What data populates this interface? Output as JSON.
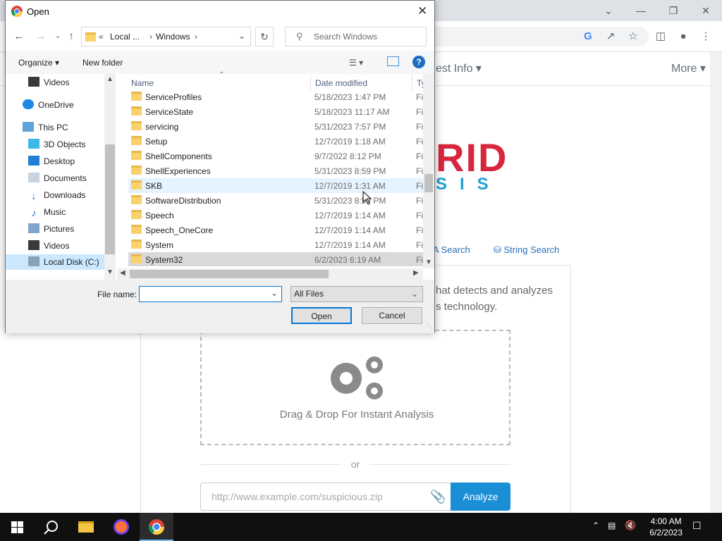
{
  "browser": {
    "nav_links": {
      "latest_info": "est Info ▾",
      "more": "More ▾"
    },
    "logo": {
      "text": "RID",
      "sub": "SIS"
    },
    "search_tabs": {
      "yara": "A Search",
      "string": "String Search"
    },
    "description": {
      "line1": "hat detects and analyzes",
      "line2": "s technology."
    },
    "dropzone_label": "Drag & Drop For Instant Analysis",
    "or_label": "or",
    "url_placeholder": "http://www.example.com/suspicious.zip",
    "analyze_label": "Analyze"
  },
  "dialog": {
    "title": "Open",
    "breadcrumb": {
      "chevrons": "«",
      "part1": "Local ...",
      "part2": "Windows"
    },
    "search_placeholder": "Search Windows",
    "organize_label": "Organize ▾",
    "new_folder_label": "New folder",
    "nav_items": [
      {
        "label": "Videos",
        "icon": "video-icon"
      },
      {
        "label": "OneDrive",
        "icon": "cloud-icon"
      },
      {
        "label": "This PC",
        "icon": "pc-icon"
      },
      {
        "label": "3D Objects",
        "icon": "cube-icon"
      },
      {
        "label": "Desktop",
        "icon": "desktop-icon"
      },
      {
        "label": "Documents",
        "icon": "document-icon"
      },
      {
        "label": "Downloads",
        "icon": "download-icon"
      },
      {
        "label": "Music",
        "icon": "music-icon"
      },
      {
        "label": "Pictures",
        "icon": "picture-icon"
      },
      {
        "label": "Videos",
        "icon": "video-icon"
      },
      {
        "label": "Local Disk (C:)",
        "icon": "drive-icon"
      }
    ],
    "columns": {
      "name": "Name",
      "date": "Date modified",
      "type": "Ty"
    },
    "files": [
      {
        "name": "ServiceProfiles",
        "date": "5/18/2023 1:47 PM",
        "type": "Fi"
      },
      {
        "name": "ServiceState",
        "date": "5/18/2023 11:17 AM",
        "type": "Fi"
      },
      {
        "name": "servicing",
        "date": "5/31/2023 7:57 PM",
        "type": "Fi"
      },
      {
        "name": "Setup",
        "date": "12/7/2019 1:18 AM",
        "type": "Fi"
      },
      {
        "name": "ShellComponents",
        "date": "9/7/2022 8:12 PM",
        "type": "Fi"
      },
      {
        "name": "ShellExperiences",
        "date": "5/31/2023 8:59 PM",
        "type": "Fi"
      },
      {
        "name": "SKB",
        "date": "12/7/2019 1:31 AM",
        "type": "Fi"
      },
      {
        "name": "SoftwareDistribution",
        "date": "5/31/2023 8:59 PM",
        "type": "Fi"
      },
      {
        "name": "Speech",
        "date": "12/7/2019 1:14 AM",
        "type": "Fi"
      },
      {
        "name": "Speech_OneCore",
        "date": "12/7/2019 1:14 AM",
        "type": "Fi"
      },
      {
        "name": "System",
        "date": "12/7/2019 1:14 AM",
        "type": "Fi"
      },
      {
        "name": "System32",
        "date": "6/2/2023 6:19 AM",
        "type": "Fi"
      }
    ],
    "filename_label": "File name:",
    "filename_value": "",
    "filter_value": "All Files",
    "open_label": "Open",
    "cancel_label": "Cancel"
  },
  "taskbar": {
    "time": "4:00 AM",
    "date": "6/2/2023"
  },
  "colors": {
    "accent": "#0078d7",
    "analyze": "#1a8fd6",
    "logo_red": "#d7263d",
    "logo_blue": "#1fa2d6"
  }
}
